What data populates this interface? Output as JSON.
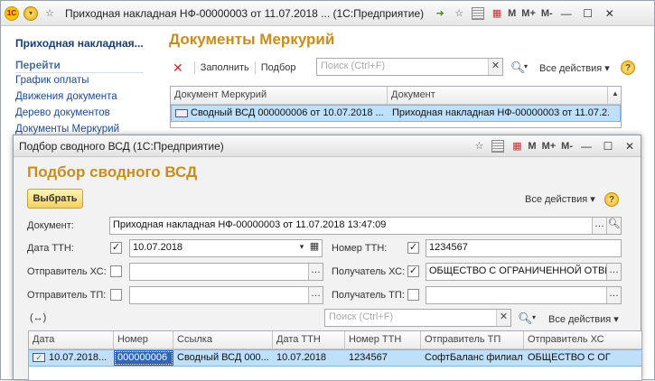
{
  "window1": {
    "title": "Приходная накладная НФ-00000003 от 11.07.2018 ...  (1С:Предприятие)",
    "m_buttons": [
      "M",
      "M+",
      "M-"
    ],
    "sidebar": {
      "title": "Приходная накладная...",
      "section": "Перейти",
      "links": [
        "График оплаты",
        "Движения документа",
        "Дерево документов",
        "Документы Меркурий"
      ]
    },
    "header": "Документы Меркурий",
    "toolbar": {
      "fill_label": "Заполнить",
      "select_label": "Подбор",
      "search_placeholder": "Поиск (Ctrl+F)",
      "all_actions": "Все действия"
    },
    "grid": {
      "columns": [
        "Документ Меркурий",
        "Документ"
      ],
      "rows": [
        [
          "Сводный ВСД 000000006 от 10.07.2018 ...",
          "Приходная накладная НФ-00000003 от 11.07.2..."
        ]
      ]
    }
  },
  "window2": {
    "title": "Подбор сводного ВСД  (1С:Предприятие)",
    "m_buttons": [
      "M",
      "M+",
      "M-"
    ],
    "header": "Подбор сводного ВСД",
    "choose_label": "Выбрать",
    "all_actions": "Все действия",
    "form": {
      "document_label": "Документ:",
      "document_value": "Приходная накладная НФ-00000003 от 11.07.2018 13:47:09",
      "ttn_date_label": "Дата ТТН:",
      "ttn_date_checked": true,
      "ttn_date_value": "10.07.2018",
      "ttn_number_label": "Номер ТТН:",
      "ttn_number_checked": true,
      "ttn_number_value": "1234567",
      "sender_hs_label": "Отправитель ХС:",
      "sender_hs_checked": false,
      "sender_hs_value": "",
      "receiver_hs_label": "Получатель ХС:",
      "receiver_hs_checked": true,
      "receiver_hs_value": "ОБЩЕСТВО С ОГРАНИЧЕННОЙ ОТВЕ",
      "sender_tp_label": "Отправитель ТП:",
      "sender_tp_checked": false,
      "sender_tp_value": "",
      "receiver_tp_label": "Получатель ТП:",
      "receiver_tp_checked": false,
      "receiver_tp_value": ""
    },
    "expand_icon_text": "(↔)",
    "search_placeholder": "Поиск (Ctrl+F)",
    "grid": {
      "columns": [
        "Дата",
        "Номер",
        "Ссылка",
        "Дата ТТН",
        "Номер ТТН",
        "Отправитель ТП",
        "Отправитель ХС"
      ],
      "rows": [
        [
          "10.07.2018...",
          "000000006",
          "Сводный ВСД 000...",
          "10.07.2018",
          "1234567",
          "СофтБаланс филиал",
          "ОБЩЕСТВО С ОГ"
        ]
      ]
    }
  }
}
